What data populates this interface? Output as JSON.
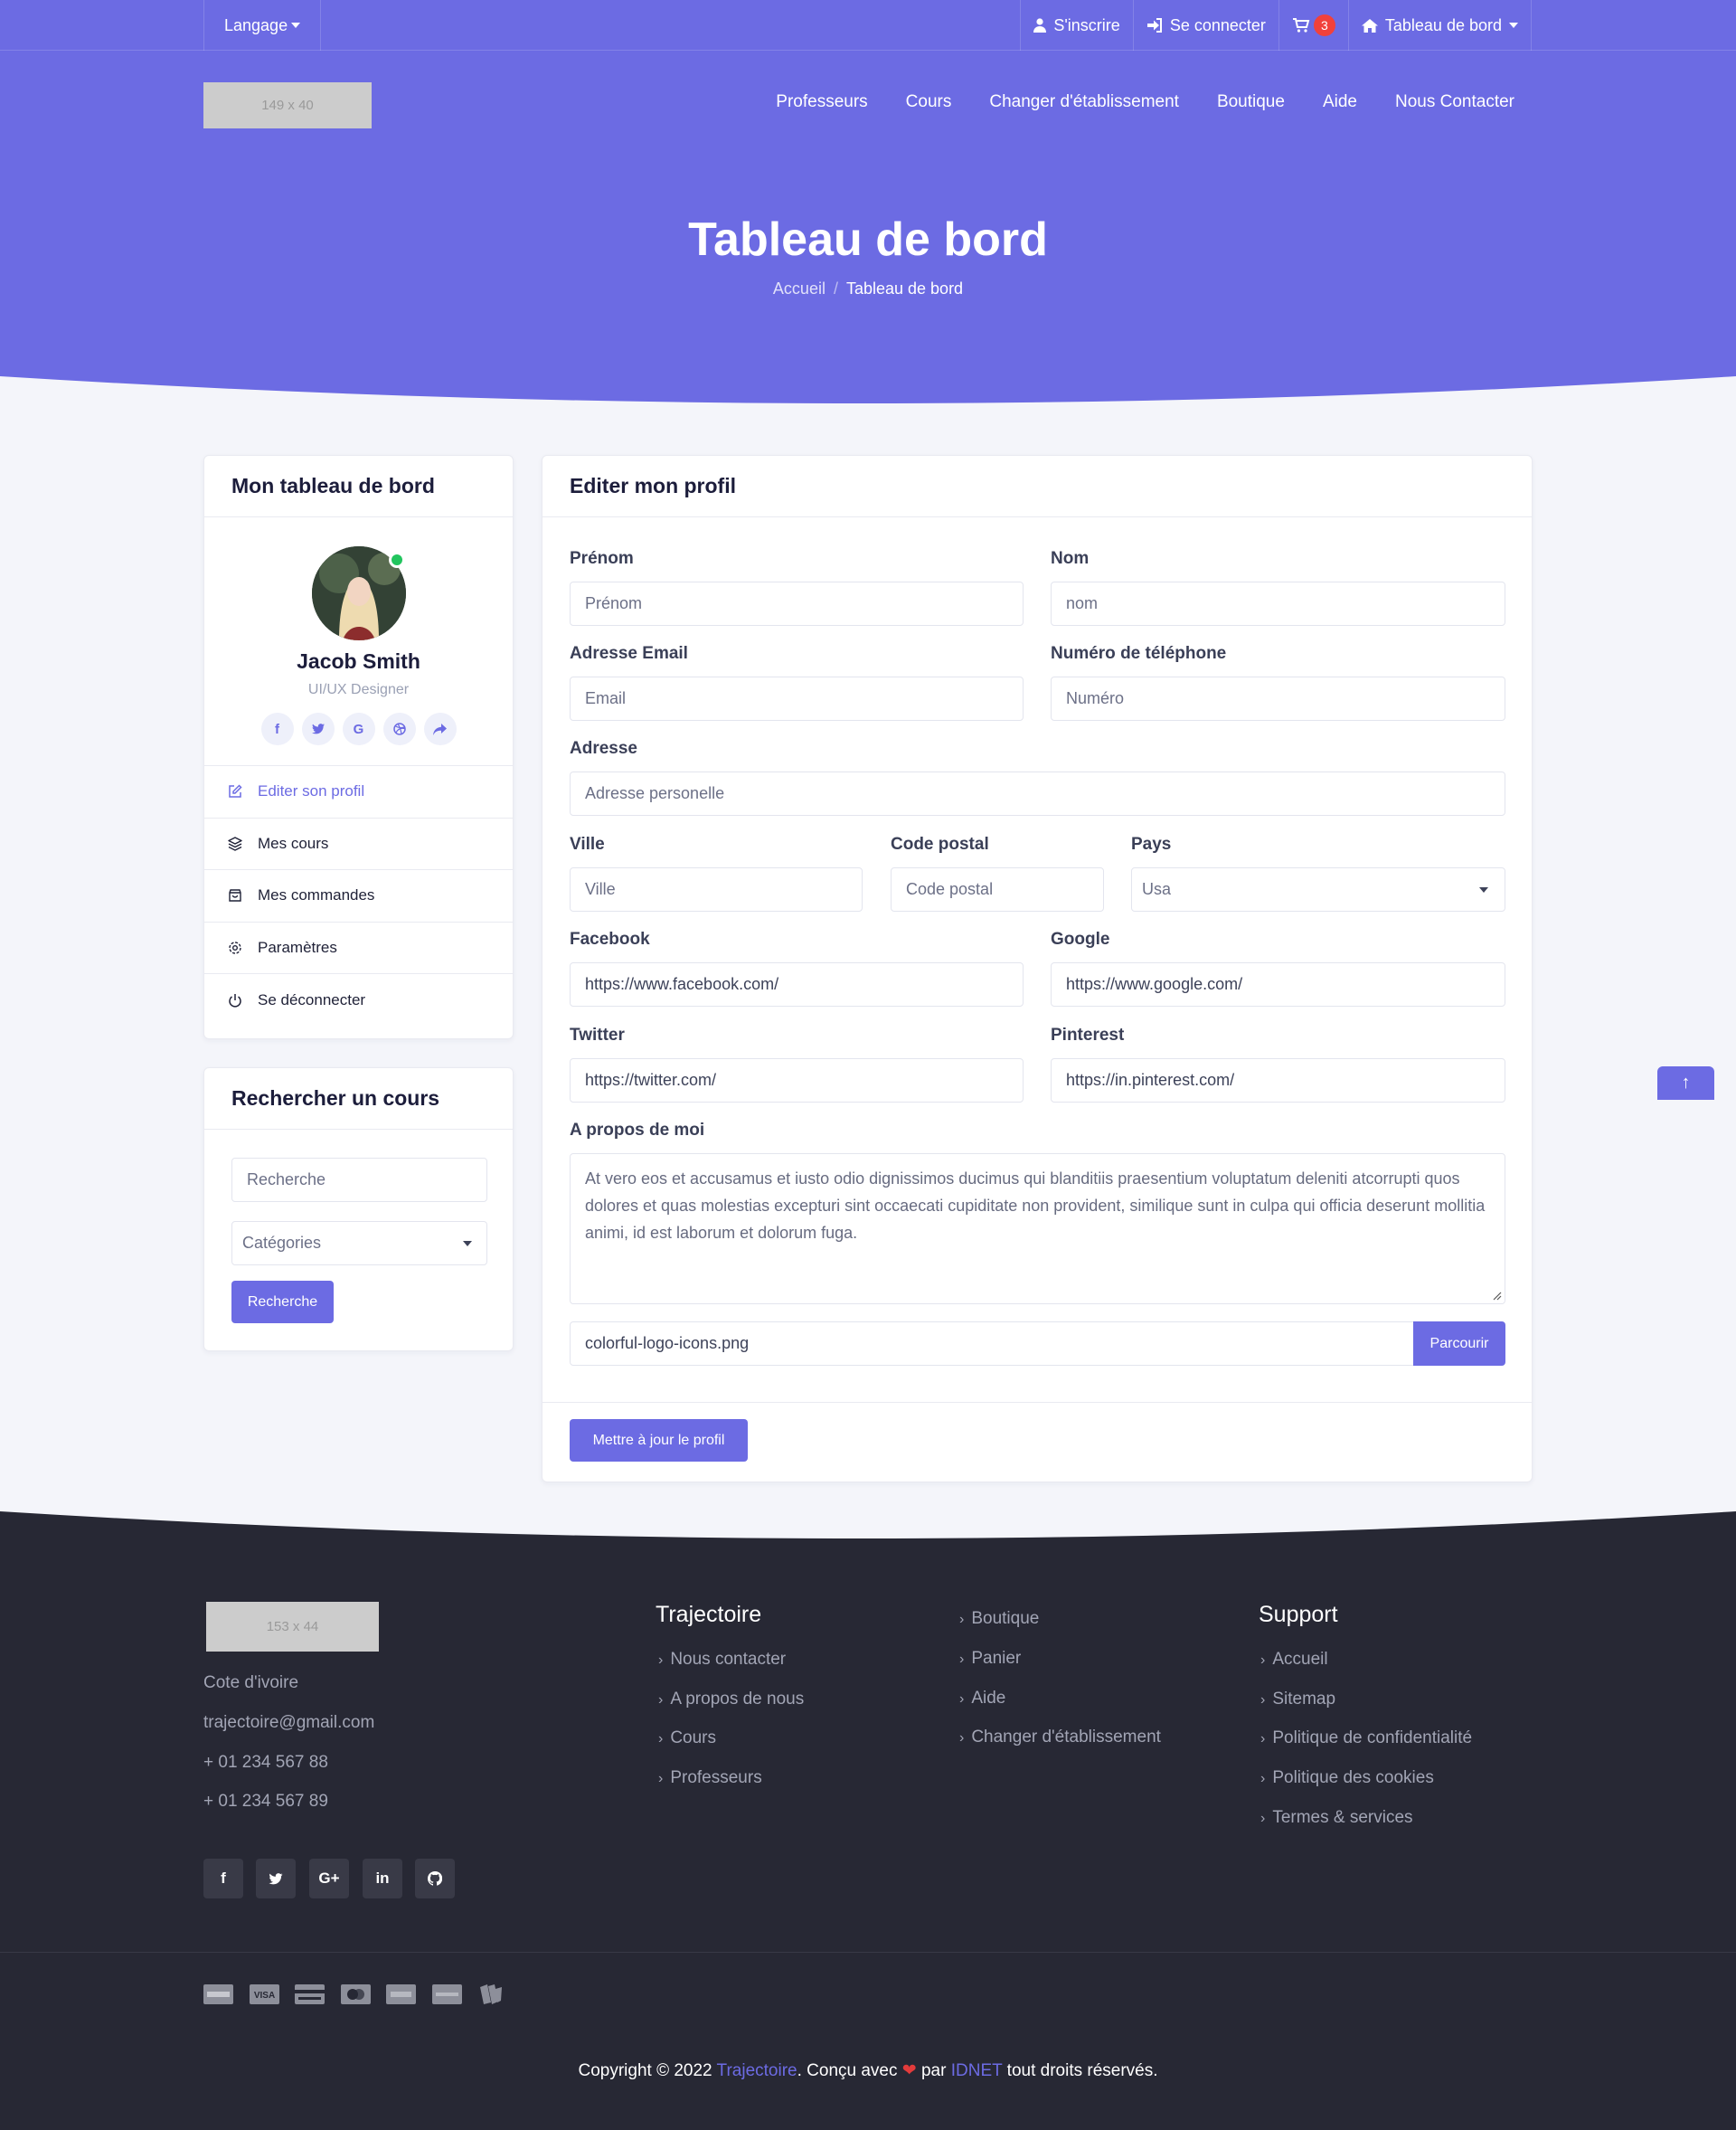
{
  "topbar": {
    "language": "Langage",
    "register": "S'inscrire",
    "login": "Se connecter",
    "cart_count": "3",
    "dashboard": "Tableau de bord"
  },
  "header": {
    "logo": "149 x 40",
    "nav": [
      "Professeurs",
      "Cours",
      "Changer d'établissement",
      "Boutique",
      "Aide",
      "Nous Contacter"
    ]
  },
  "hero": {
    "title": "Tableau de bord",
    "breadcrumb": [
      "Accueil",
      "Tableau de bord"
    ]
  },
  "sidebar": {
    "title": "Mon tableau de bord",
    "profile": {
      "name": "Jacob Smith",
      "role": "UI/UX Designer"
    },
    "social_icons": [
      "facebook-icon",
      "twitter-icon",
      "google-icon",
      "dribbble-icon",
      "share-icon"
    ],
    "menu": [
      {
        "label": "Editer son profil",
        "icon": "edit-icon",
        "active": true
      },
      {
        "label": "Mes cours",
        "icon": "layers-icon"
      },
      {
        "label": "Mes commandes",
        "icon": "shopping-bag-icon"
      },
      {
        "label": "Paramètres",
        "icon": "gear-icon"
      },
      {
        "label": "Se déconnecter",
        "icon": "power-icon"
      }
    ]
  },
  "search_card": {
    "title": "Rechercher un cours",
    "search_placeholder": "Recherche",
    "category": "Catégories",
    "button": "Recherche"
  },
  "profile_form": {
    "title": "Editer mon profil",
    "first_name": {
      "label": "Prénom",
      "placeholder": "Prénom"
    },
    "last_name": {
      "label": "Nom",
      "placeholder": "nom"
    },
    "email": {
      "label": "Adresse Email",
      "placeholder": "Email"
    },
    "phone": {
      "label": "Numéro de téléphone",
      "placeholder": "Numéro"
    },
    "address": {
      "label": "Adresse",
      "placeholder": "Adresse personelle"
    },
    "city": {
      "label": "Ville",
      "placeholder": "Ville"
    },
    "zip": {
      "label": "Code postal",
      "placeholder": "Code postal"
    },
    "country": {
      "label": "Pays",
      "value": "Usa"
    },
    "facebook": {
      "label": "Facebook",
      "value": "https://www.facebook.com/"
    },
    "google": {
      "label": "Google",
      "value": "https://www.google.com/"
    },
    "twitter": {
      "label": "Twitter",
      "value": "https://twitter.com/"
    },
    "pinterest": {
      "label": "Pinterest",
      "value": "https://in.pinterest.com/"
    },
    "about": {
      "label": "A propos de moi",
      "value": "At vero eos et accusamus et iusto odio dignissimos ducimus qui blanditiis praesentium voluptatum deleniti atcorrupti quos dolores et quas molestias excepturi sint occaecati cupiditate non provident, similique sunt in culpa qui officia deserunt mollitia animi, id est laborum et dolorum fuga."
    },
    "file": {
      "name": "colorful-logo-icons.png",
      "button": "Parcourir"
    },
    "submit": "Mettre à jour le profil"
  },
  "footer": {
    "logo": "153 x 44",
    "contact": [
      "Cote d'ivoire",
      "trajectoire@gmail.com",
      "+ 01 234 567 88",
      "+ 01 234 567 89"
    ],
    "social_icons": [
      "facebook-icon",
      "twitter-icon",
      "google-plus-icon",
      "linkedin-icon",
      "github-icon"
    ],
    "col1": {
      "title": "Trajectoire",
      "links": [
        "Nous contacter",
        "A propos de nous",
        "Cours",
        "Professeurs"
      ]
    },
    "col2": {
      "links": [
        "Boutique",
        "Panier",
        "Aide",
        "Changer d'établissement"
      ]
    },
    "col3": {
      "title": "Support",
      "links": [
        "Accueil",
        "Sitemap",
        "Politique de confidentialité",
        "Politique des cookies",
        "Termes & services"
      ]
    },
    "payment_icons": [
      "amex-card-icon",
      "visa-card-icon",
      "generic-card-icon",
      "mastercard-icon",
      "paypal-icon",
      "discover-card-icon",
      "wallet-icon"
    ],
    "copyright": {
      "prefix": "Copyright © 2022 ",
      "brand": "Trajectoire",
      "middle": ". Conçu avec ",
      "by": " par ",
      "author": "IDNET",
      "suffix": " tout droits réservés."
    }
  },
  "colors": {
    "primary": "#6c6be3",
    "footer_bg": "#272834",
    "online": "#22c55e",
    "badge": "#f1413b"
  }
}
